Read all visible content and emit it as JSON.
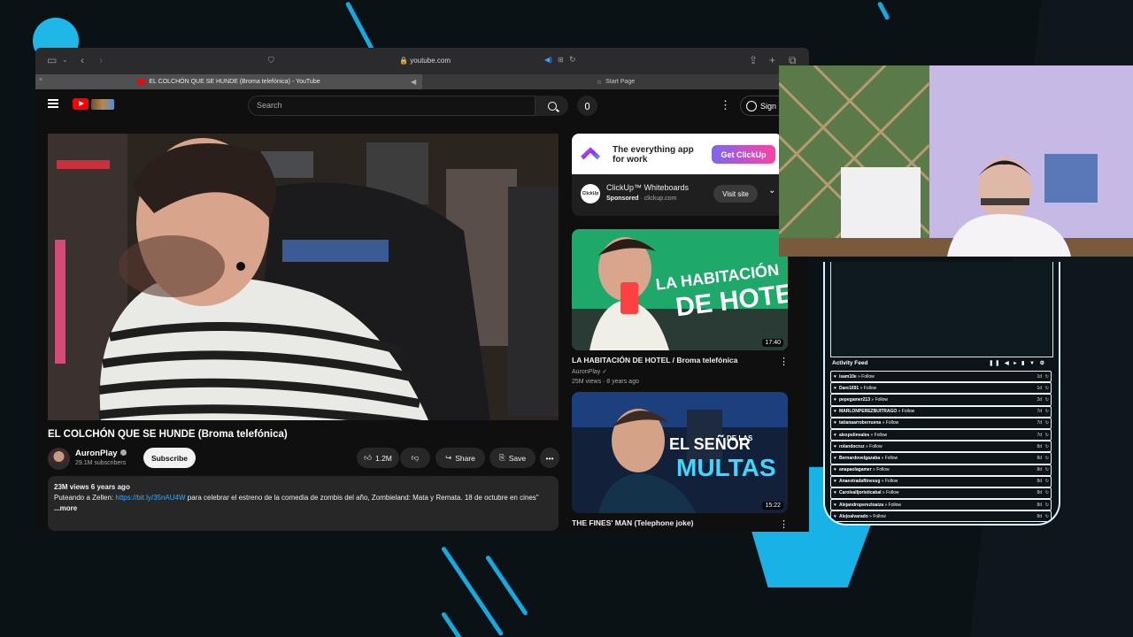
{
  "browser": {
    "address": "youtube.com",
    "tabs": [
      {
        "label": "EL COLCHÓN QUE SE HUNDE (Broma telefónica) - YouTube",
        "active": true
      },
      {
        "label": "Start Page",
        "active": false
      }
    ]
  },
  "youtube": {
    "search_placeholder": "Search",
    "signin_label": "Sign in",
    "video": {
      "title": "EL COLCHÓN QUE SE HUNDE (Broma telefónica)",
      "channel": "AuronPlay",
      "subscribers": "29.1M subscribers",
      "subscribe_label": "Subscribe",
      "likes": "1.2M",
      "share_label": "Share",
      "save_label": "Save",
      "views_date": "23M views  6 years ago",
      "description_prefix": "Puteando a Zellen: ",
      "description_link": "https://bit.ly/35nAU4W",
      "description_rest": " para celebrar el estreno de la comedia de zombis del año, Zombieland: Mata y Remata.  18 de octubre en cines\"",
      "more_label": "...more"
    },
    "ad": {
      "headline": "The everything app for work",
      "cta": "Get ClickUp",
      "name": "ClickUp™ Whiteboards",
      "sponsored": "Sponsored",
      "domain": "· clickup.com",
      "visit_label": "Visit site",
      "avatar_label": "ClickUp"
    },
    "related": [
      {
        "title": "LA HABITACIÓN DE HOTEL / Broma telefónica",
        "channel": "AuronPlay",
        "meta": "25M views · 8 years ago",
        "duration": "17:40",
        "thumb_text": [
          "LA HABITACIÓN",
          "DE HOTEL"
        ]
      },
      {
        "title": "THE FINES' MAN (Telephone joke)",
        "duration": "15:22",
        "thumb_text": [
          "EL SEÑOR",
          "DE LAS",
          "MULTAS"
        ]
      }
    ]
  },
  "activity_feed": {
    "title": "Activity Feed",
    "items": [
      {
        "user": "isam10e",
        "action": "Follow",
        "age": "1d"
      },
      {
        "user": "Dare1691",
        "action": "Follow",
        "age": "1d"
      },
      {
        "user": "pepegamer213",
        "action": "Follow",
        "age": "2d"
      },
      {
        "user": "MARLONPEREZBUITRAGO",
        "action": "Follow",
        "age": "7d"
      },
      {
        "user": "tatianaarroberruena",
        "action": "Follow",
        "age": "7d"
      },
      {
        "user": "alexpolinvales",
        "action": "Follow",
        "age": "7d"
      },
      {
        "user": "rolandocruz",
        "action": "Follow",
        "age": "8d"
      },
      {
        "user": "Bernardovelgazaba",
        "action": "Follow",
        "age": "8d"
      },
      {
        "user": "anapaolagamer",
        "action": "Follow",
        "age": "8d"
      },
      {
        "user": "Anaestradafitnessg",
        "action": "Follow",
        "age": "8d"
      },
      {
        "user": "Carolvalljoristicabal",
        "action": "Follow",
        "age": "8d"
      },
      {
        "user": "Alejandroperezloaiza",
        "action": "Follow",
        "age": "8d"
      },
      {
        "user": "Alejoalvarado",
        "action": "Follow",
        "age": "8d"
      }
    ]
  },
  "colors": {
    "accent": "#1fb6e8",
    "youtube_red": "#ff0000",
    "link": "#3ea6ff"
  }
}
